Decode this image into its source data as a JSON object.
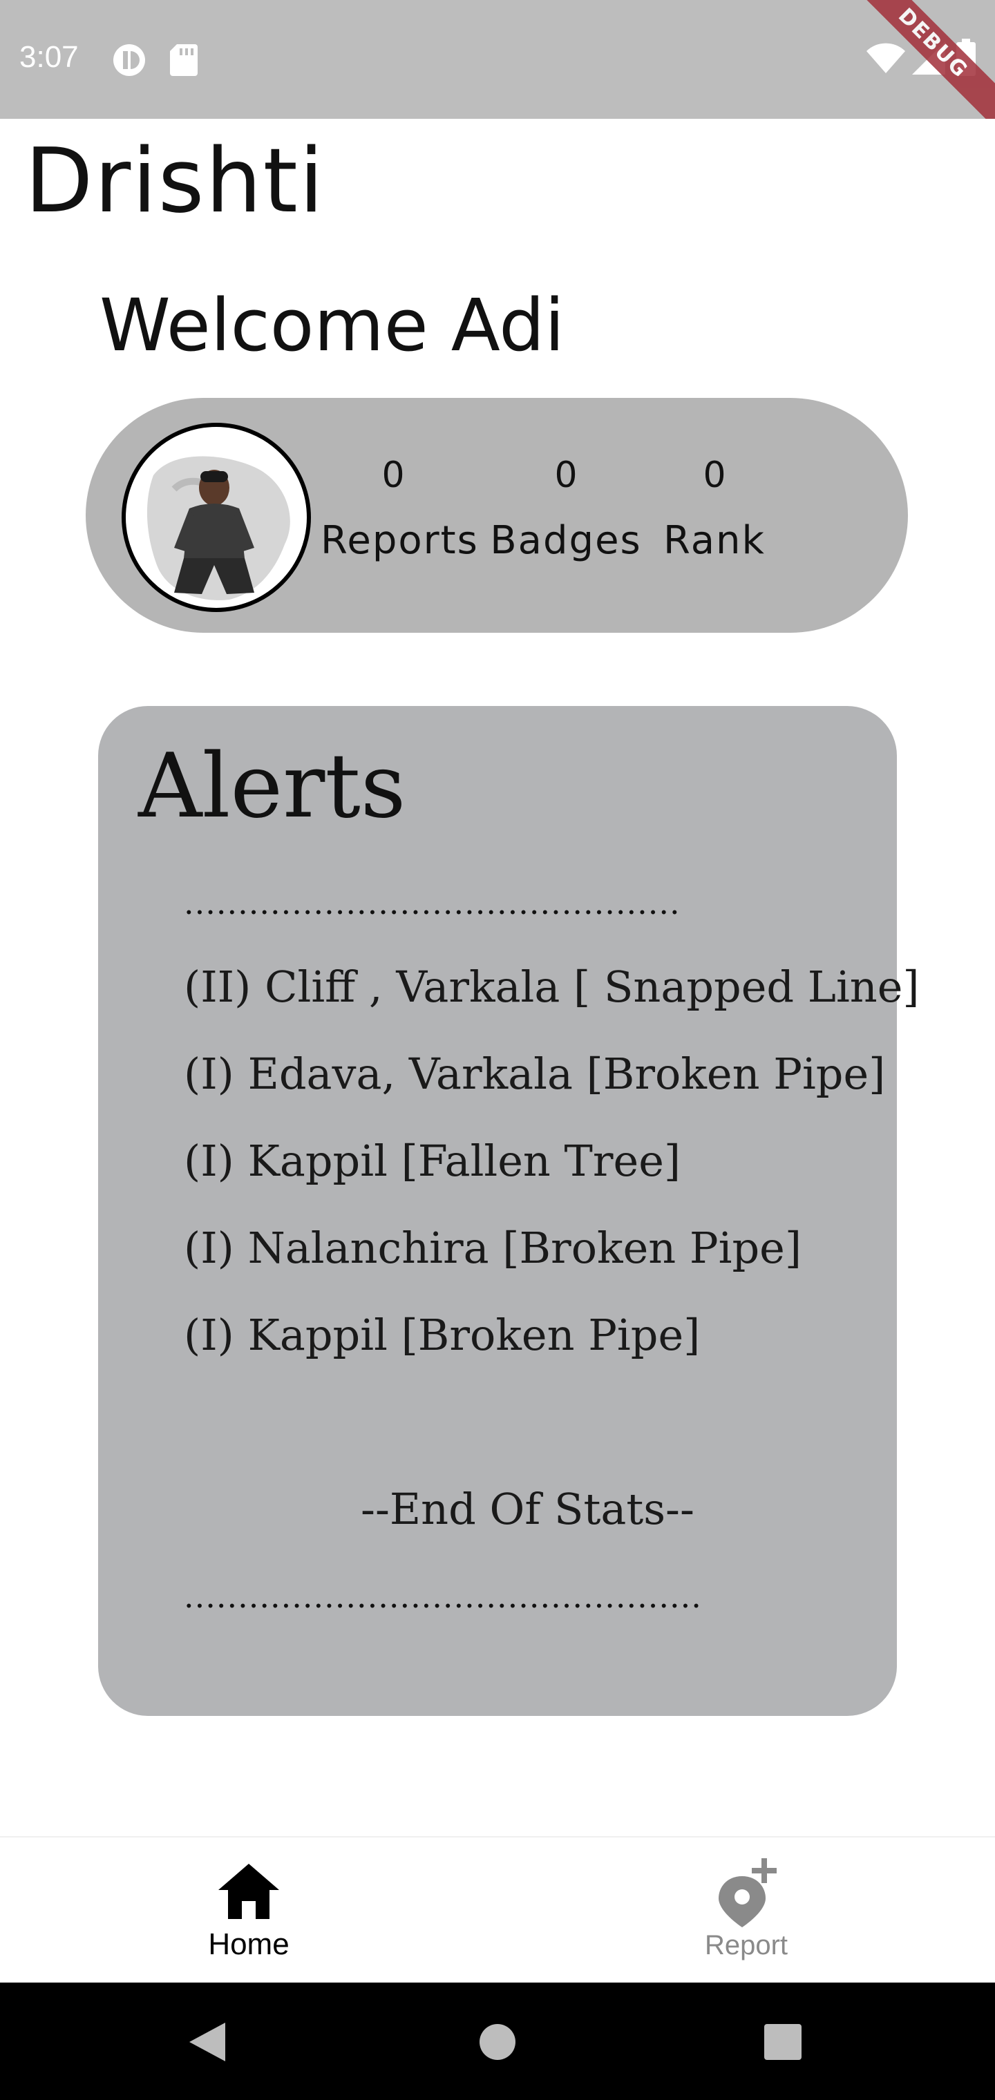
{
  "status_bar": {
    "time": "3:07",
    "icons": [
      "privacy-icon",
      "sd-card-icon",
      "wifi-icon",
      "signal-icon",
      "battery-icon"
    ],
    "debug_label": "DEBUG"
  },
  "app": {
    "title": "Drishti"
  },
  "welcome": {
    "text": "Welcome Adi"
  },
  "profile": {
    "stats": [
      {
        "value": "0",
        "label": "Reports"
      },
      {
        "value": "0",
        "label": "Badges"
      },
      {
        "value": "0",
        "label": "Rank"
      }
    ]
  },
  "alerts": {
    "title": "Alerts",
    "top_separator": "..............................................",
    "items": [
      "(II) Cliff , Varkala [ Snapped Line]",
      "(I) Edava, Varkala [Broken Pipe]",
      "(I) Kappil [Fallen Tree]",
      "(I) Nalanchira [Broken Pipe]",
      "(I) Kappil [Broken Pipe]"
    ],
    "end_text": "--End Of Stats--",
    "bottom_separator": "................................................"
  },
  "bottom_nav": {
    "items": [
      {
        "label": "Home",
        "icon": "home-icon",
        "active": true
      },
      {
        "label": "Report",
        "icon": "add-location-icon",
        "active": false
      }
    ],
    "active_color": "#000000",
    "inactive_color": "#8a8a8a"
  },
  "colors": {
    "status_bar": "#bdbdbd",
    "card": "#b5b5b5",
    "debug_ribbon": "#a2303a"
  }
}
